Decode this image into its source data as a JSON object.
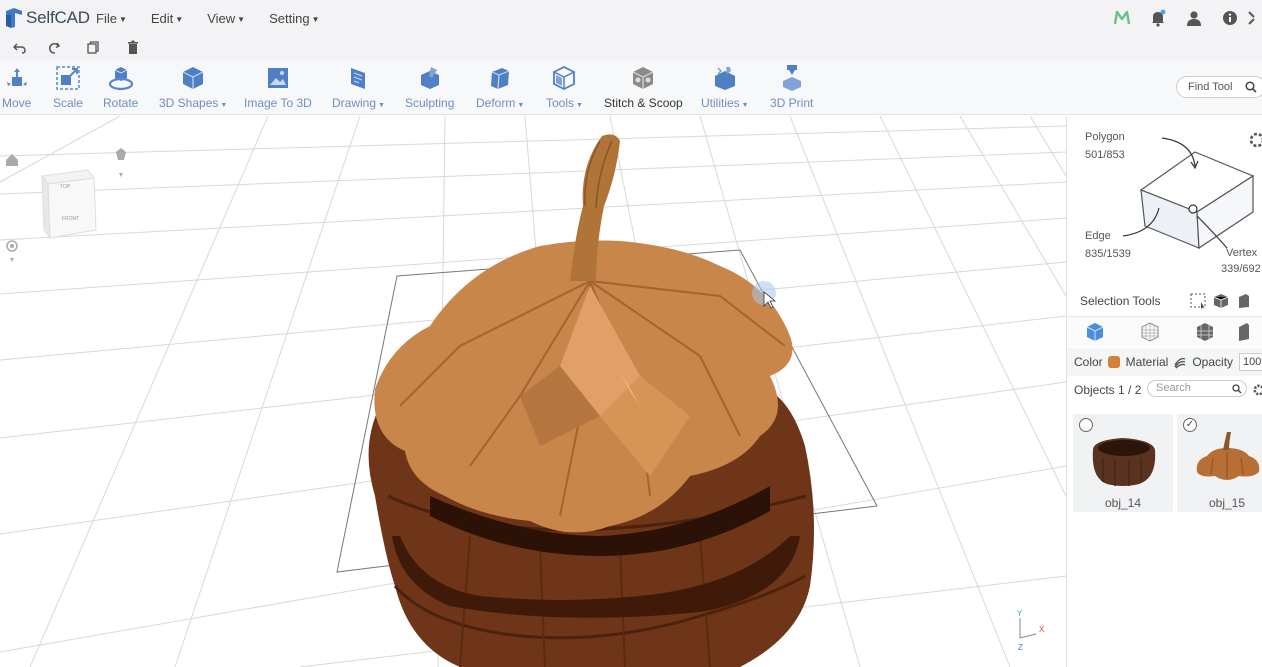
{
  "app": {
    "name": "SelfCAD"
  },
  "menu": [
    {
      "label": "File"
    },
    {
      "label": "Edit"
    },
    {
      "label": "View"
    },
    {
      "label": "Setting"
    }
  ],
  "header_icons": [
    "m-icon",
    "notification-bell-icon",
    "user-icon",
    "info-icon",
    "fullscreen-icon"
  ],
  "undo_icons": [
    "undo-icon",
    "redo-icon",
    "copy-icon",
    "delete-icon"
  ],
  "toolbar": {
    "tools": [
      {
        "label": "Move",
        "has_menu": false
      },
      {
        "label": "Scale",
        "has_menu": false
      },
      {
        "label": "Rotate",
        "has_menu": false
      },
      {
        "label": "3D Shapes",
        "has_menu": true
      },
      {
        "label": "Image To 3D",
        "has_menu": false
      },
      {
        "label": "Drawing",
        "has_menu": true
      },
      {
        "label": "Sculpting",
        "has_menu": false
      },
      {
        "label": "Deform",
        "has_menu": true
      },
      {
        "label": "Tools",
        "has_menu": true
      },
      {
        "label": "Stitch & Scoop",
        "has_menu": false
      },
      {
        "label": "Utilities",
        "has_menu": true
      },
      {
        "label": "3D Print",
        "has_menu": false
      }
    ],
    "find_tool_placeholder": "Find Tool"
  },
  "view_cube": {
    "top_label": "TOP",
    "front_label": "FRONT"
  },
  "axis": {
    "y_label": "Y",
    "x_label": "X",
    "z_label": "Z"
  },
  "selection": {
    "polygon_label": "Polygon",
    "polygon_count": "501/853",
    "edge_label": "Edge",
    "edge_count": "835/1539",
    "vertex_label": "Vertex",
    "vertex_count": "339/692",
    "tools_title": "Selection Tools"
  },
  "properties": {
    "color_label": "Color",
    "color_value": "#d4823a",
    "material_label": "Material",
    "opacity_label": "Opacity",
    "opacity_value": "100"
  },
  "objects": {
    "label": "Objects 1 / 2",
    "search_placeholder": "Search",
    "items": [
      {
        "name": "obj_14",
        "checked": false
      },
      {
        "name": "obj_15",
        "checked": true
      }
    ]
  },
  "colors": {
    "accent_blue": "#6c8fc2",
    "pumpkin_top": "#c9864a",
    "pumpkin_base": "#6e3518"
  }
}
